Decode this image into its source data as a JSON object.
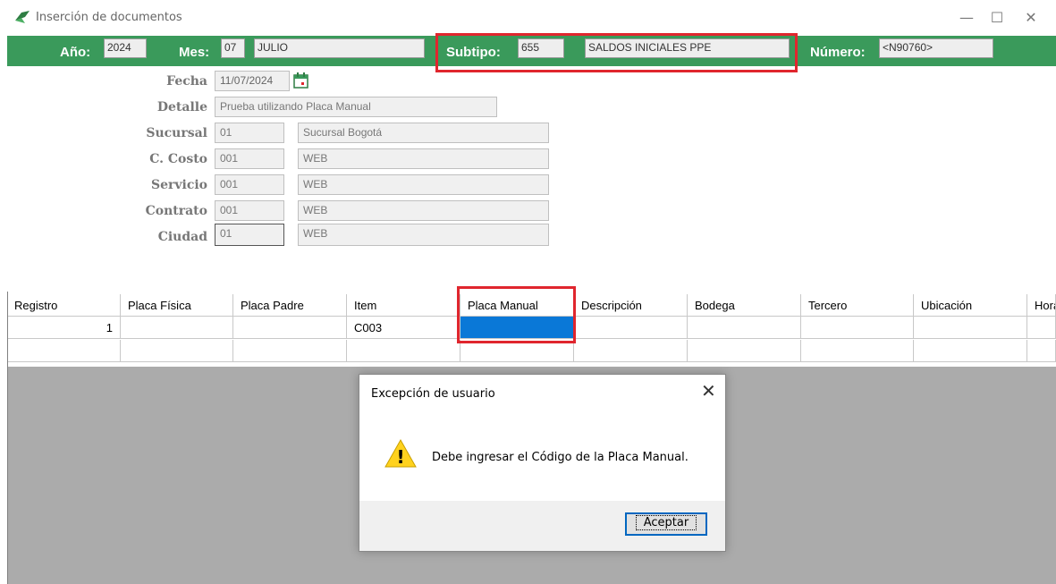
{
  "window": {
    "title": "Inserción de documentos",
    "minimize": "—",
    "maximize": "☐",
    "close": "✕"
  },
  "header": {
    "year_label": "Año:",
    "year": "2024",
    "month_label": "Mes:",
    "month": "07",
    "month_name": "JULIO",
    "subtype_label": "Subtipo:",
    "subtype": "655",
    "subtype_name": "SALDOS INICIALES PPE",
    "number_label": "Número:",
    "number": "<N90760>"
  },
  "form": {
    "fecha_label": "Fecha",
    "fecha": "11/07/2024",
    "detalle_label": "Detalle",
    "detalle": "Prueba utilizando Placa Manual",
    "sucursal_label": "Sucursal",
    "sucursal_code": "01",
    "sucursal_name": "Sucursal Bogotá",
    "costo_label": "C. Costo",
    "costo_code": "001",
    "costo_name": "WEB",
    "servicio_label": "Servicio",
    "servicio_code": "001",
    "servicio_name": "WEB",
    "contrato_label": "Contrato",
    "contrato_code": "001",
    "contrato_name": "WEB",
    "ciudad_label": "Ciudad",
    "ciudad_code": "01",
    "ciudad_name": "WEB"
  },
  "grid": {
    "columns": [
      "Registro",
      "Placa Física",
      "Placa Padre",
      "Item",
      "Placa Manual",
      "Descripción",
      "Bodega",
      "Tercero",
      "Ubicación",
      "Hora"
    ],
    "rows": [
      [
        "1",
        "",
        "",
        "C003",
        "",
        "",
        "",
        "",
        "",
        ""
      ],
      [
        "",
        "",
        "",
        "",
        "",
        "",
        "",
        "",
        "",
        ""
      ]
    ]
  },
  "dialog": {
    "title": "Excepción de usuario",
    "close": "✕",
    "message": "Debe ingresar el Código de la Placa Manual.",
    "ok_label": "Aceptar",
    "warning_glyph": "!"
  },
  "colors": {
    "header_green": "#3a9a5b",
    "highlight_red": "#e0262e",
    "selection_blue": "#0a78d7"
  }
}
